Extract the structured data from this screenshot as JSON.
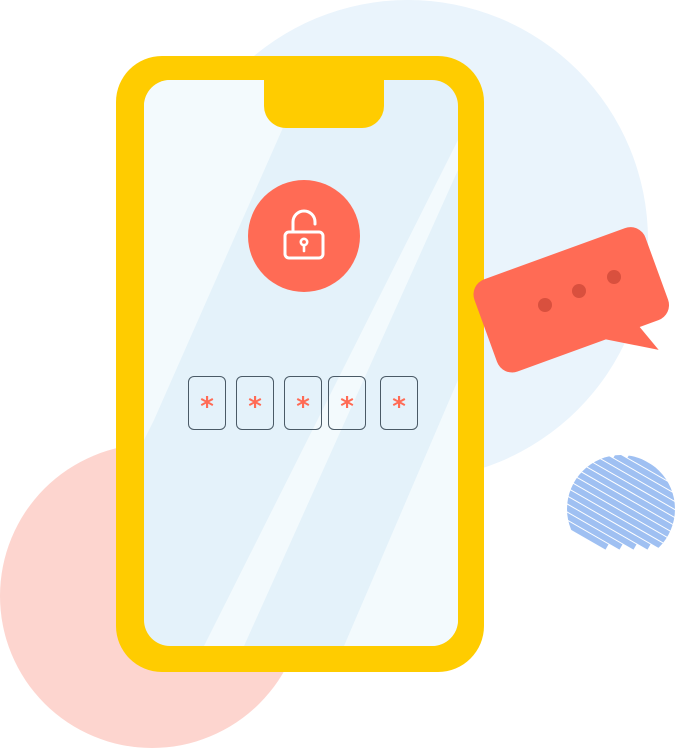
{
  "colors": {
    "background": "#ffffff",
    "circle_blue": "#eaf4fc",
    "circle_pink": "#fdd5cf",
    "stripes": "#9fc0f2",
    "phone_frame": "#ffcc00",
    "screen": "#e4f2fa",
    "screen_glare": "#f3fafd",
    "accent": "#ff6b55"
  },
  "lock": {
    "icon": "padlock-icon"
  },
  "pin": {
    "mask_char": "*",
    "digits": [
      "*",
      "*",
      "*",
      "*",
      "*"
    ]
  },
  "chat_bubble": {
    "icon": "ellipsis-icon",
    "dots": 3
  }
}
